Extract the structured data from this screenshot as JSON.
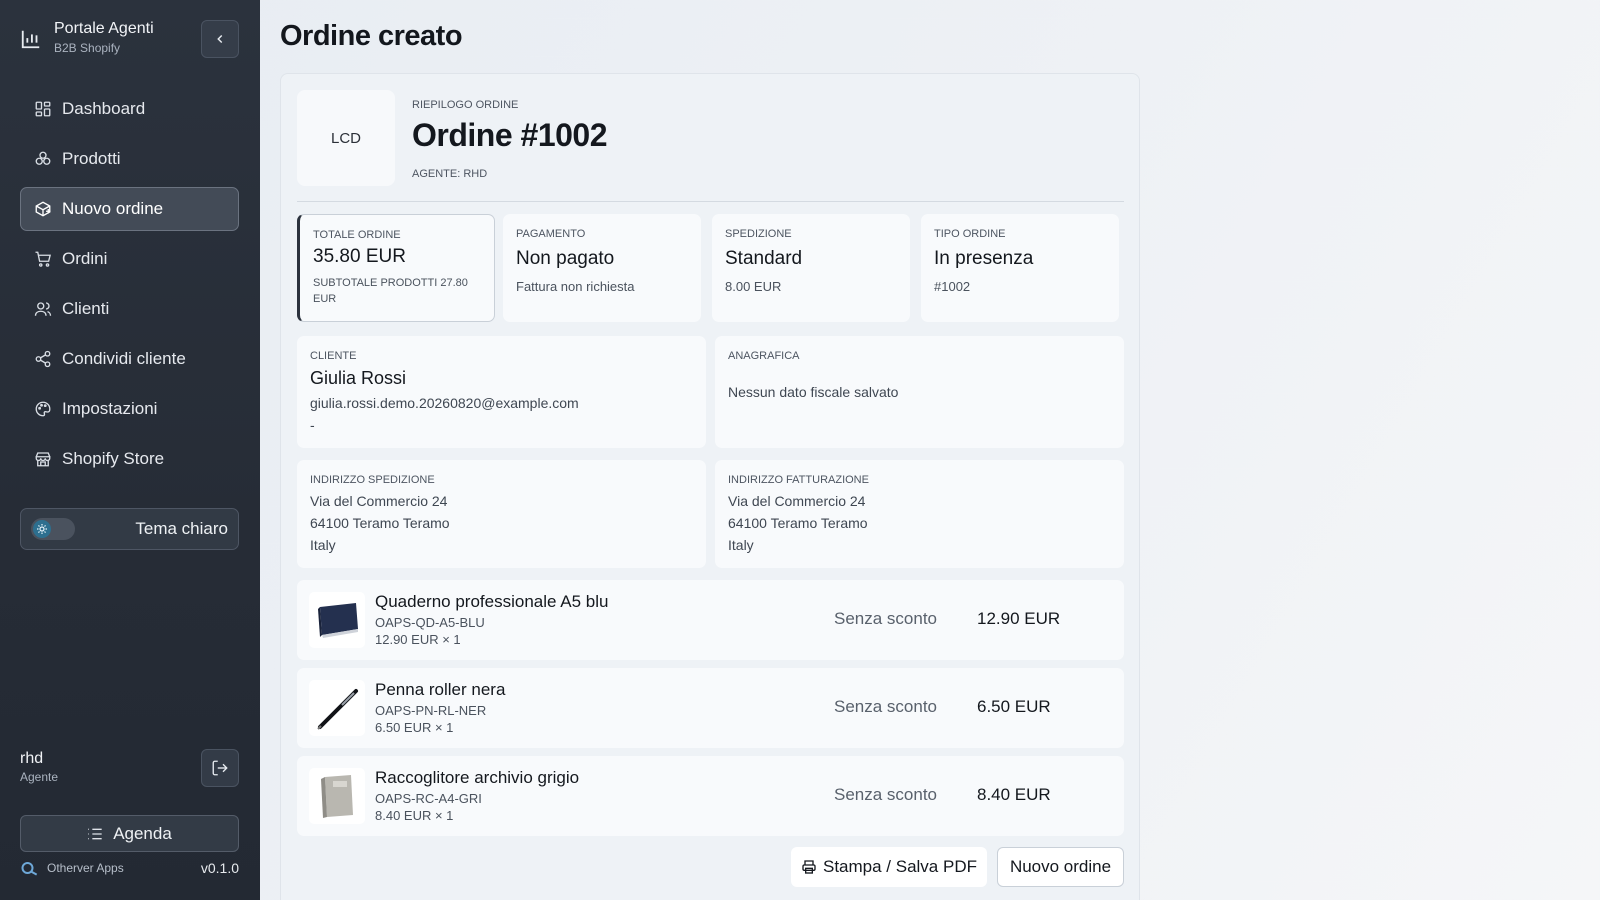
{
  "sidebar": {
    "brand": {
      "title": "Portale Agenti",
      "subtitle": "B2B Shopify"
    },
    "nav": [
      {
        "label": "Dashboard",
        "icon": "dashboard-icon",
        "active": false
      },
      {
        "label": "Prodotti",
        "icon": "products-icon",
        "active": false
      },
      {
        "label": "Nuovo ordine",
        "icon": "new-order-icon",
        "active": true
      },
      {
        "label": "Ordini",
        "icon": "cart-icon",
        "active": false
      },
      {
        "label": "Clienti",
        "icon": "users-icon",
        "active": false
      },
      {
        "label": "Condividi cliente",
        "icon": "share-icon",
        "active": false
      },
      {
        "label": "Impostazioni",
        "icon": "palette-icon",
        "active": false
      },
      {
        "label": "Shopify Store",
        "icon": "store-icon",
        "active": false
      }
    ],
    "theme_label": "Tema chiaro",
    "user": {
      "name": "rhd",
      "role": "Agente"
    },
    "agenda_label": "Agenda",
    "footer_brand": "Otherver Apps",
    "version": "v0.1.0"
  },
  "page": {
    "title": "Ordine creato"
  },
  "order": {
    "logo_text": "LCD",
    "summary_label": "RIEPILOGO ORDINE",
    "title": "Ordine #1002",
    "agent": "AGENTE: RHD"
  },
  "stats": [
    {
      "label": "TOTALE ORDINE",
      "value": "35.80 EUR",
      "sub": "SUBTOTALE PRODOTTI 27.80 EUR"
    },
    {
      "label": "PAGAMENTO",
      "value": "Non pagato",
      "sub": "Fattura non richiesta"
    },
    {
      "label": "SPEDIZIONE",
      "value": "Standard",
      "sub": "8.00 EUR"
    },
    {
      "label": "TIPO ORDINE",
      "value": "In presenza",
      "sub": "#1002"
    }
  ],
  "customer": {
    "label": "CLIENTE",
    "name": "Giulia Rossi",
    "email": "giulia.rossi.demo.20260820@example.com",
    "phone": "-"
  },
  "registry": {
    "label": "ANAGRAFICA",
    "text": "Nessun dato fiscale salvato"
  },
  "shipping_address": {
    "label": "INDIRIZZO SPEDIZIONE",
    "line1": "Via del Commercio 24",
    "line2": "64100 Teramo Teramo",
    "line3": "Italy"
  },
  "billing_address": {
    "label": "INDIRIZZO FATTURAZIONE",
    "line1": "Via del Commercio 24",
    "line2": "64100 Teramo Teramo",
    "line3": "Italy"
  },
  "items": [
    {
      "name": "Quaderno professionale A5 blu",
      "sku": "OAPS-QD-A5-BLU",
      "qty": "12.90 EUR × 1",
      "discount": "Senza sconto",
      "price": "12.90 EUR",
      "thumb": "notebook-thumbnail"
    },
    {
      "name": "Penna roller nera",
      "sku": "OAPS-PN-RL-NER",
      "qty": "6.50 EUR × 1",
      "discount": "Senza sconto",
      "price": "6.50 EUR",
      "thumb": "pen-thumbnail"
    },
    {
      "name": "Raccoglitore archivio grigio",
      "sku": "OAPS-RC-A4-GRI",
      "qty": "8.40 EUR × 1",
      "discount": "Senza sconto",
      "price": "8.40 EUR",
      "thumb": "binder-thumbnail"
    }
  ],
  "actions": {
    "print_label": "Stampa / Salva PDF",
    "new_order_label": "Nuovo ordine"
  },
  "colors": {
    "sidebar_bg": "#2b323d",
    "accent": "#2d6f8f",
    "page_bg": "#eef1f5"
  }
}
